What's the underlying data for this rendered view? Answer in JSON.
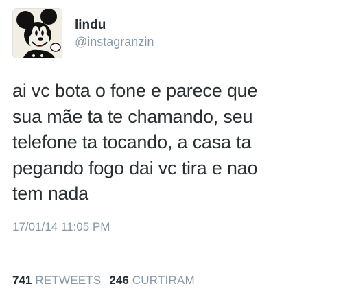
{
  "user": {
    "display_name": "lindu",
    "handle": "@instagranzin",
    "avatar_icon": "mickey-mouse-avatar"
  },
  "tweet": {
    "lines": [
      "ai vc bota o fone e parece que",
      "sua mãe ta te chamando, seu",
      "telefone ta tocando, a casa ta",
      "pegando fogo dai vc tira e nao",
      "tem nada"
    ],
    "timestamp": "17/01/14 11:05 PM"
  },
  "stats": {
    "retweets_count": "741",
    "retweets_label": "RETWEETS",
    "likes_count": "246",
    "likes_label": "CURTIRAM"
  },
  "colors": {
    "text": "#292f33",
    "muted": "#8899a6",
    "divider": "#e1e8ed"
  }
}
